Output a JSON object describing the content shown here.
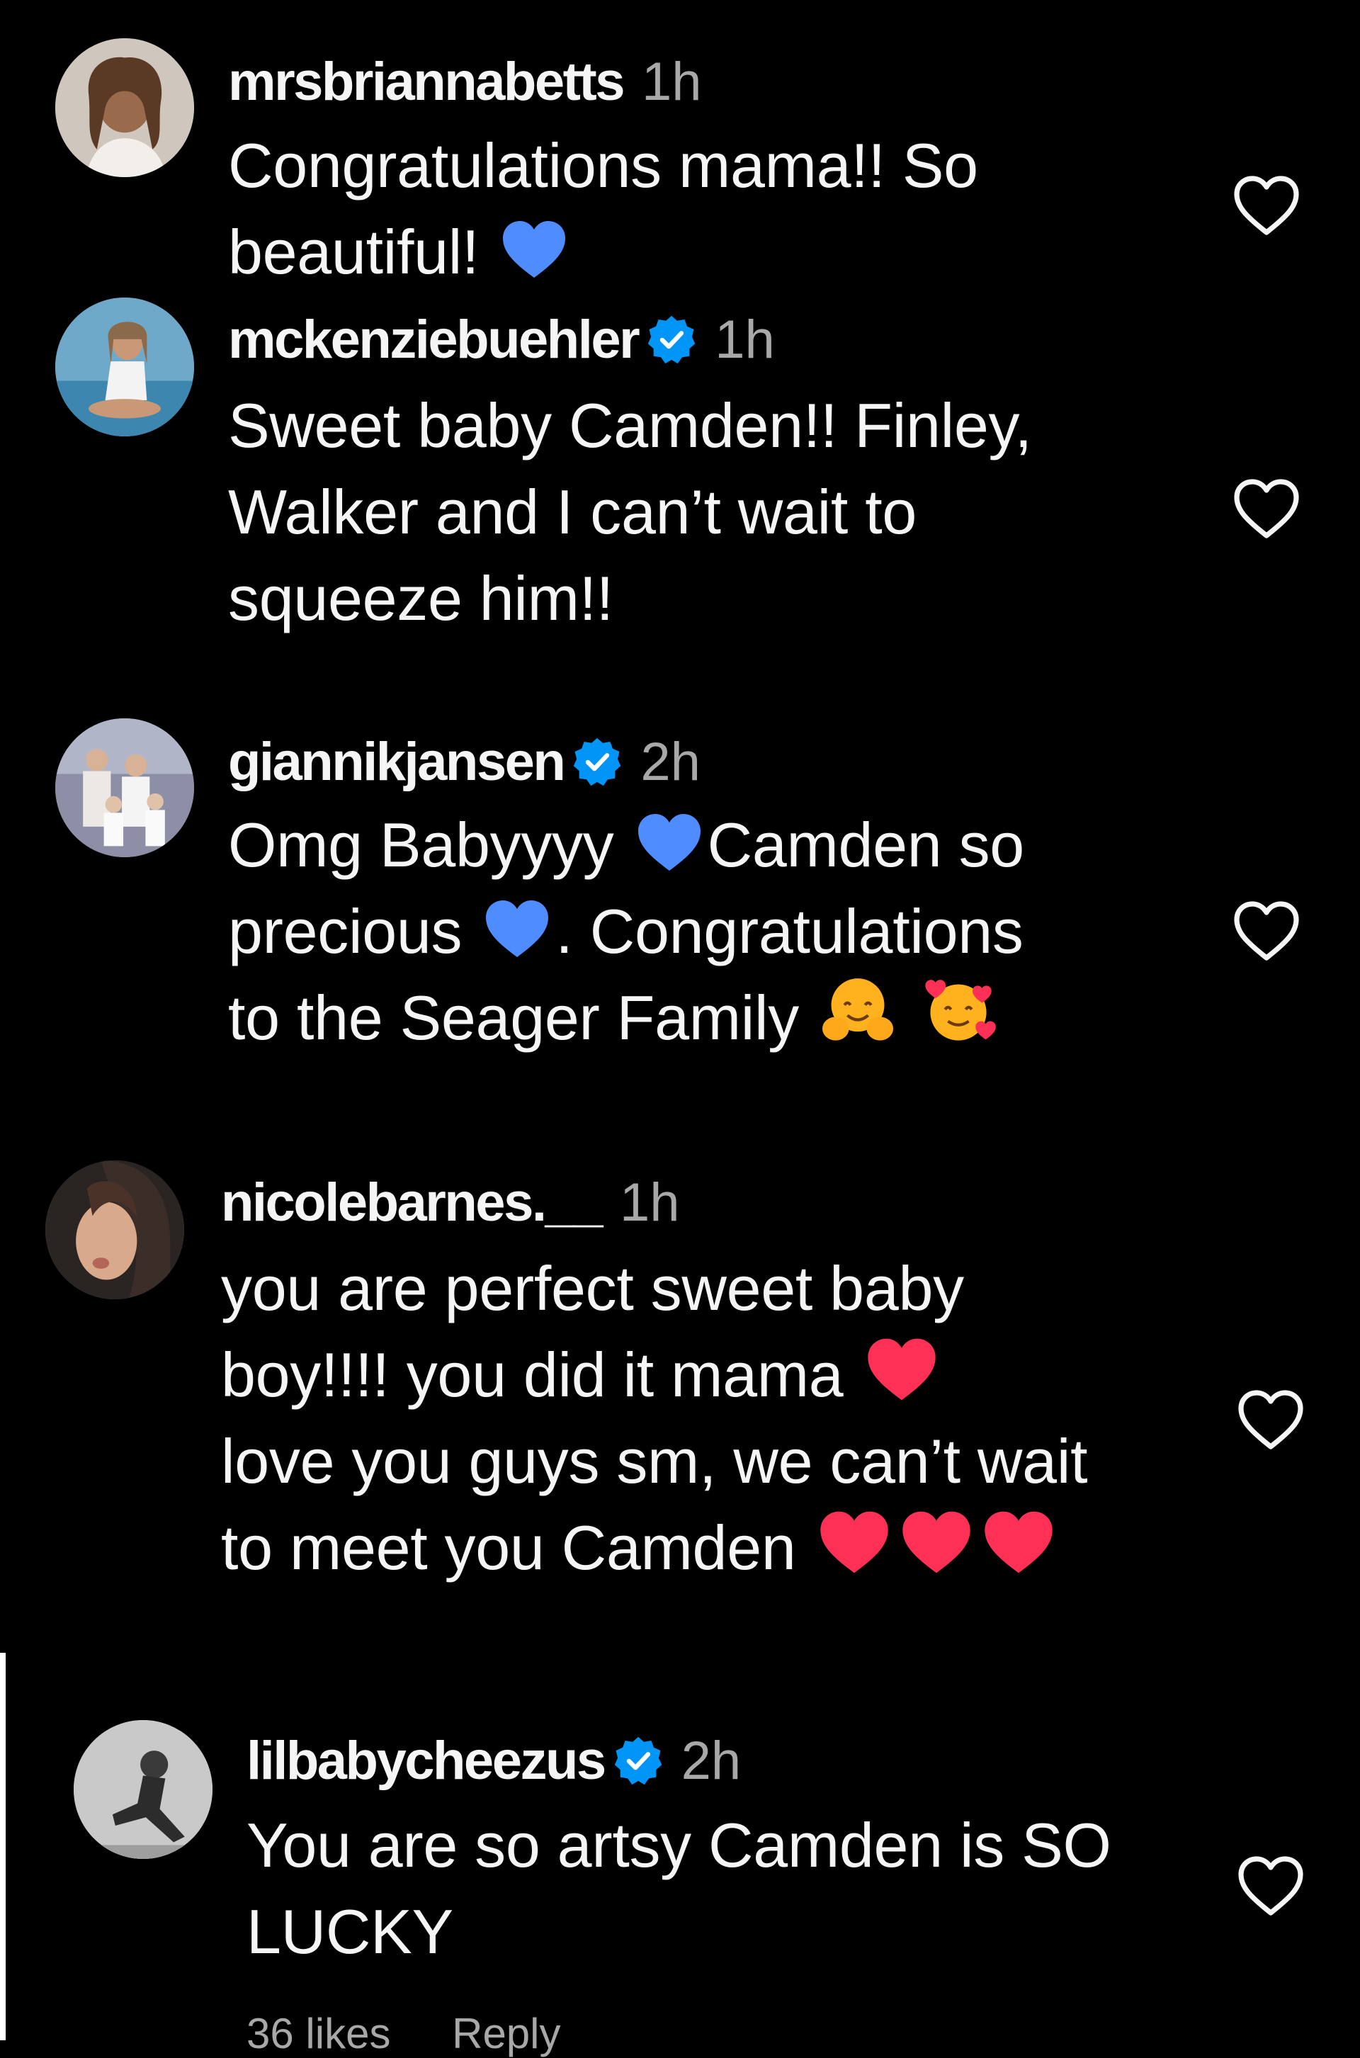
{
  "comments": [
    {
      "username": "mrsbriannabetts",
      "verified": false,
      "time": "1h",
      "lines": [
        "Congratulations mama!! So",
        "beautiful! "
      ]
    },
    {
      "username": "mckenziebuehler",
      "verified": true,
      "time": "1h",
      "lines": [
        "Sweet baby Camden!! Finley,",
        "Walker and I can’t wait to",
        "squeeze him!!"
      ]
    },
    {
      "username": "giannikjansen",
      "verified": true,
      "time": "2h",
      "line1_a": "Omg Babyyyy",
      "line1_b": "Camden so",
      "line2_a": "precious",
      "line2_b": ". Congratulations",
      "line3": "to the Seager Family"
    },
    {
      "username": "nicolebarnes.__",
      "verified": false,
      "time": "1h",
      "line1": "you are perfect sweet baby",
      "line2": "boy!!!! you did it mama",
      "line3": "love you guys sm, we can’t wait",
      "line4": "to meet you Camden"
    },
    {
      "username": "lilbabycheezus",
      "verified": true,
      "time": "2h",
      "lines": [
        "You are so artsy Camden is SO",
        "LUCKY"
      ],
      "likes": "36 likes",
      "reply": "Reply"
    }
  ],
  "icons": {
    "like": "heart-outline-icon",
    "verified": "verified-badge-icon",
    "blue_heart": "blue-heart-emoji",
    "red_heart": "red-heart-emoji",
    "hug": "hugging-face-emoji",
    "hearts_face": "smiling-face-with-hearts-emoji"
  },
  "colors": {
    "background": "#000000",
    "text": "#f5f5f5",
    "muted": "#a8a8a8",
    "verified": "#0095f6",
    "blue_heart": "#4f8cff",
    "red_heart": "#ff3056"
  }
}
